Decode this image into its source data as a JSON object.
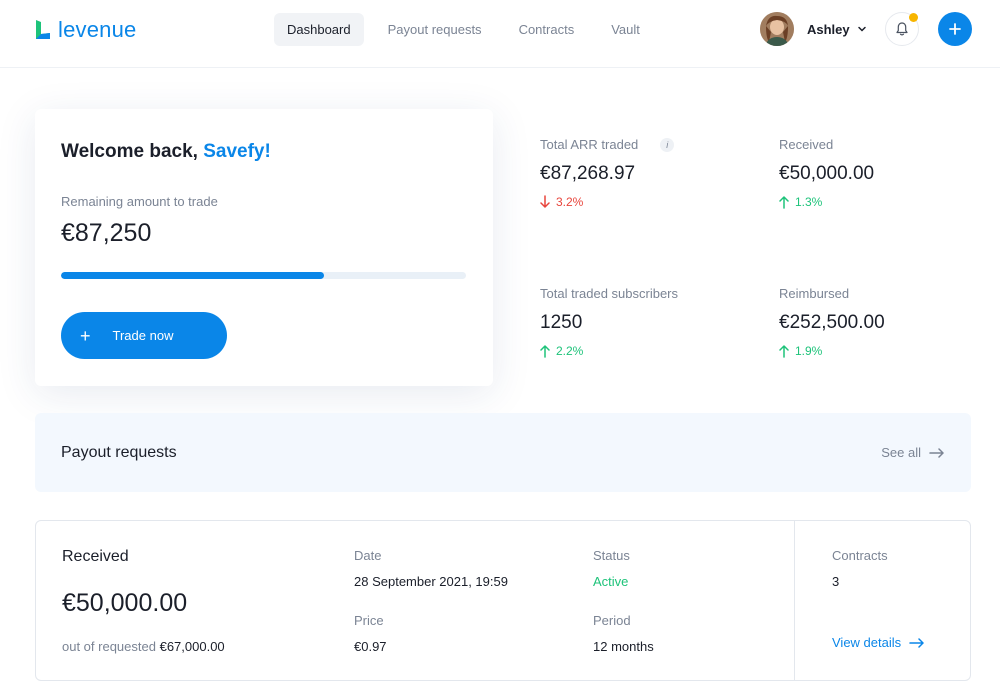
{
  "brand": {
    "logo_text": "levenue",
    "accent": "#0a86e8"
  },
  "nav": {
    "items": [
      {
        "label": "Dashboard",
        "active": true
      },
      {
        "label": "Payout requests",
        "active": false
      },
      {
        "label": "Contracts",
        "active": false
      },
      {
        "label": "Vault",
        "active": false
      }
    ]
  },
  "user": {
    "name": "Ashley",
    "notification_dot_color": "#f7b500"
  },
  "welcome": {
    "greeting": "Welcome back,",
    "company": "Savefy!",
    "remaining_label": "Remaining amount to trade",
    "remaining_value": "€87,250",
    "progress_fraction": 0.65,
    "trade_button_label": "Trade now"
  },
  "stats": [
    {
      "label": "Total ARR traded",
      "value": "€87,268.97",
      "change": "3.2%",
      "direction": "down",
      "info_icon": "i"
    },
    {
      "label": "Received",
      "value": "€50,000.00",
      "change": "1.3%",
      "direction": "up"
    },
    {
      "label": "Total traded subscribers",
      "value": "1250",
      "change": "2.2%",
      "direction": "up"
    },
    {
      "label": "Reimbursed",
      "value": "€252,500.00",
      "change": "1.9%",
      "direction": "up"
    }
  ],
  "payout_section": {
    "title": "Payout requests",
    "see_all_label": "See all"
  },
  "request": {
    "title": "Received",
    "amount": "€50,000.00",
    "sub_prefix": "out of requested",
    "sub_amount": "€67,000.00",
    "date_label": "Date",
    "date_value": "28 September 2021, 19:59",
    "price_label": "Price",
    "price_value": "€0.97",
    "status_label": "Status",
    "status_value": "Active",
    "period_label": "Period",
    "period_value": "12 months",
    "contracts_label": "Contracts",
    "contracts_value": "3",
    "view_details_label": "View details"
  }
}
